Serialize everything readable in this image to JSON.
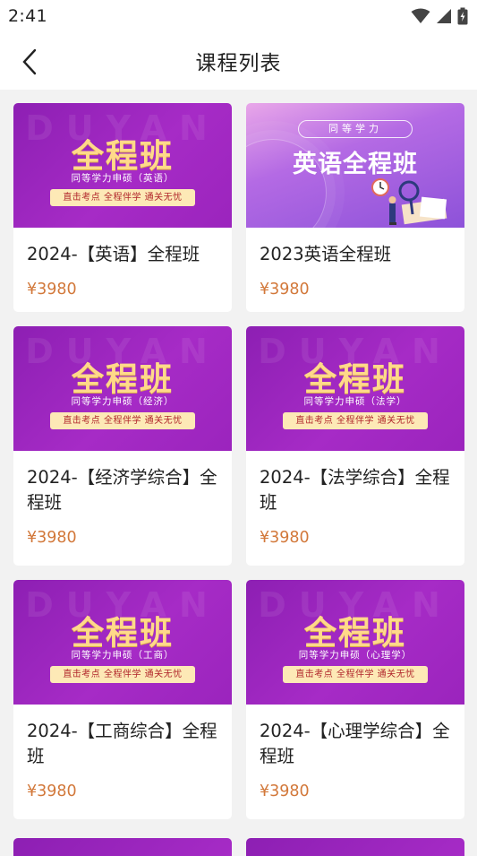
{
  "status_bar": {
    "time": "2:41"
  },
  "header": {
    "title": "课程列表"
  },
  "cover": {
    "watermark": "DUYAN",
    "big_title": "全程班",
    "tag": "直击考点 全程伴学 通关无忧"
  },
  "english_cover": {
    "pill": "同等学力",
    "title": "英语全程班"
  },
  "courses": [
    {
      "title": "2024-【英语】全程班",
      "price": "¥3980",
      "cover_sub": "同等学力申硕（英语）"
    },
    {
      "title": "2023英语全程班",
      "price": "¥3980"
    },
    {
      "title": "2024-【经济学综合】全程班",
      "price": "¥3980",
      "cover_sub": "同等学力申硕（经济）"
    },
    {
      "title": "2024-【法学综合】全程班",
      "price": "¥3980",
      "cover_sub": "同等学力申硕（法学）"
    },
    {
      "title": "2024-【工商综合】全程班",
      "price": "¥3980",
      "cover_sub": "同等学力申硕（工商）"
    },
    {
      "title": "2024-【心理学综合】全程班",
      "price": "¥3980",
      "cover_sub": "同等学力申硕（心理学）"
    }
  ]
}
